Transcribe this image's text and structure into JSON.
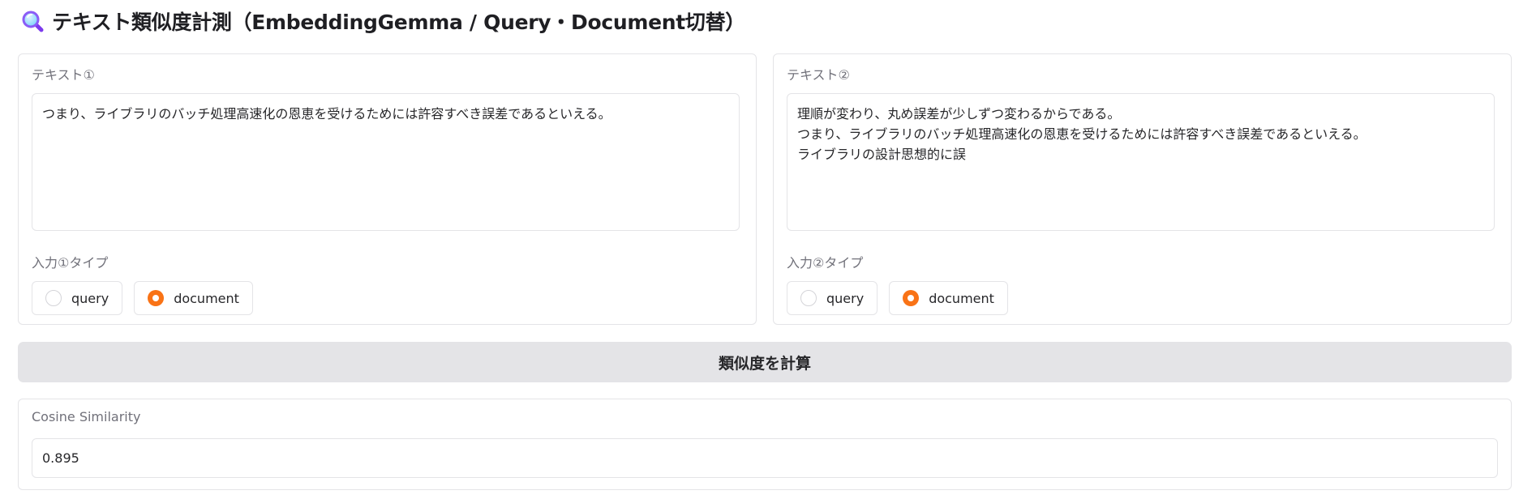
{
  "header": {
    "title": "テキスト類似度計測（EmbeddingGemma / Query・Document切替）",
    "icon": "magnifier-icon"
  },
  "input1": {
    "label": "テキスト①",
    "text": "つまり、ライブラリのバッチ処理高速化の恩恵を受けるためには許容すべき誤差であるといえる。",
    "type_label": "入力①タイプ",
    "options": [
      "query",
      "document"
    ],
    "selected": "document"
  },
  "input2": {
    "label": "テキスト②",
    "text": "理順が変わり、丸め誤差が少しずつ変わるからである。\nつまり、ライブラリのバッチ処理高速化の恩恵を受けるためには許容すべき誤差であるといえる。\nライブラリの設計思想的に誤",
    "type_label": "入力②タイプ",
    "options": [
      "query",
      "document"
    ],
    "selected": "document"
  },
  "compute_button_label": "類似度を計算",
  "result": {
    "label": "Cosine Similarity",
    "value": "0.895"
  },
  "colors": {
    "accent": "#f97316",
    "button_bg": "#e4e4e7",
    "border": "#e4e4e7"
  }
}
